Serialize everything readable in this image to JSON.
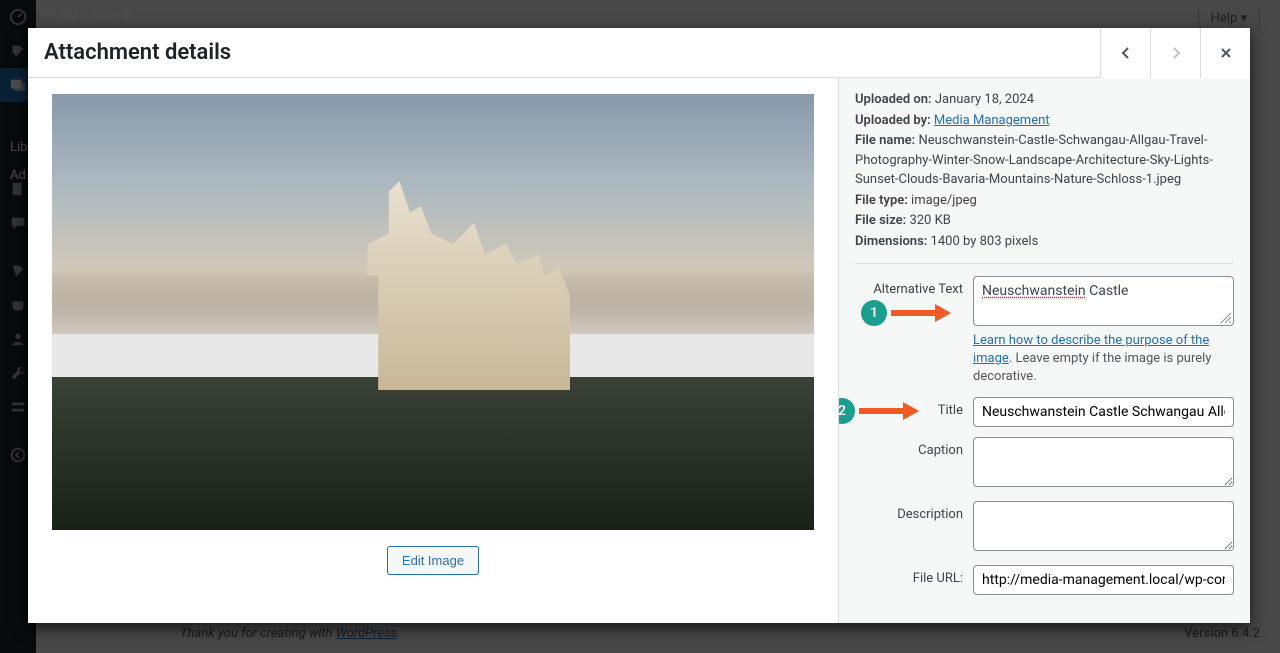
{
  "sidebar": {
    "visible_text_1": "Lib",
    "visible_text_2": "Ad"
  },
  "background": {
    "dashboard_label": "Dashboard",
    "help_label": "Help ▾",
    "footer_thanks_pre": "Thank you for creating with ",
    "footer_thanks_link": "WordPress",
    "footer_thanks_post": ".",
    "version": "Version 6.4.2"
  },
  "modal": {
    "title": "Attachment details",
    "edit_image": "Edit Image"
  },
  "meta": {
    "uploaded_on_label": "Uploaded on:",
    "uploaded_on_value": "January 18, 2024",
    "uploaded_by_label": "Uploaded by:",
    "uploaded_by_value": "Media Management",
    "file_name_label": "File name:",
    "file_name_value": "Neuschwanstein-Castle-Schwangau-Allgau-Travel-Photography-Winter-Snow-Landscape-Architecture-Sky-Lights-Sunset-Clouds-Bavaria-Mountains-Nature-Schloss-1.jpeg",
    "file_type_label": "File type:",
    "file_type_value": "image/jpeg",
    "file_size_label": "File size:",
    "file_size_value": "320 KB",
    "dimensions_label": "Dimensions:",
    "dimensions_value": "1400 by 803 pixels"
  },
  "fields": {
    "alt_label": "Alternative Text",
    "alt_value_spell": "Neuschwanstein",
    "alt_value_rest": " Castle",
    "alt_help_link": "Learn how to describe the purpose of the image",
    "alt_help_rest": ". Leave empty if the image is purely decorative.",
    "title_label": "Title",
    "title_value": "Neuschwanstein Castle Schwangau Allgau",
    "caption_label": "Caption",
    "caption_value": "",
    "description_label": "Description",
    "description_value": "",
    "file_url_label": "File URL:",
    "file_url_value": "http://media-management.local/wp-content/uploads/..."
  },
  "annotations": {
    "one": "1",
    "two": "2"
  }
}
